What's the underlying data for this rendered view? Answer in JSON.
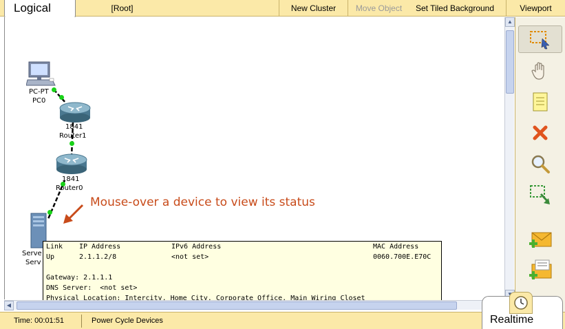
{
  "header": {
    "mode_title": "Logical",
    "root_label": "[Root]",
    "new_cluster": "New Cluster",
    "move_object": "Move Object",
    "set_tiled_background": "Set Tiled Background",
    "viewport": "Viewport"
  },
  "devices": {
    "pc": {
      "type": "PC-PT",
      "name": "PC0"
    },
    "router1": {
      "type": "1841",
      "name": "Router1"
    },
    "router0": {
      "type": "1841",
      "name": "Router0"
    },
    "server": {
      "type": "Serve",
      "name": "Serv"
    }
  },
  "annotation": "Mouse-over a device to view its status",
  "tooltip": {
    "headers": {
      "link": "Link",
      "ip": "IP Address",
      "ipv6": "IPv6 Address",
      "mac": "MAC Address"
    },
    "row": {
      "link": "Up",
      "ip": "2.1.1.2/8",
      "ipv6": "<not set>",
      "mac": "0060.700E.E70C"
    },
    "gateway": "Gateway: 2.1.1.1",
    "dns": "DNS Server:  <not set>",
    "location": "Physical Location: Intercity, Home City, Corporate Office, Main Wiring Closet"
  },
  "footer": {
    "time": "Time: 00:01:51",
    "power_cycle": "Power Cycle Devices",
    "realtime": "Realtime"
  },
  "tools": [
    "select-icon",
    "hand-icon",
    "note-icon",
    "delete-icon",
    "inspect-icon",
    "resize-shape-icon",
    "add-simple-pdu-icon",
    "add-complex-pdu-icon"
  ],
  "colors": {
    "toolbar": "#fbe9a8",
    "link_up": "#19d219",
    "annotation": "#c84b1a",
    "tooltip_bg": "#ffffe1"
  }
}
